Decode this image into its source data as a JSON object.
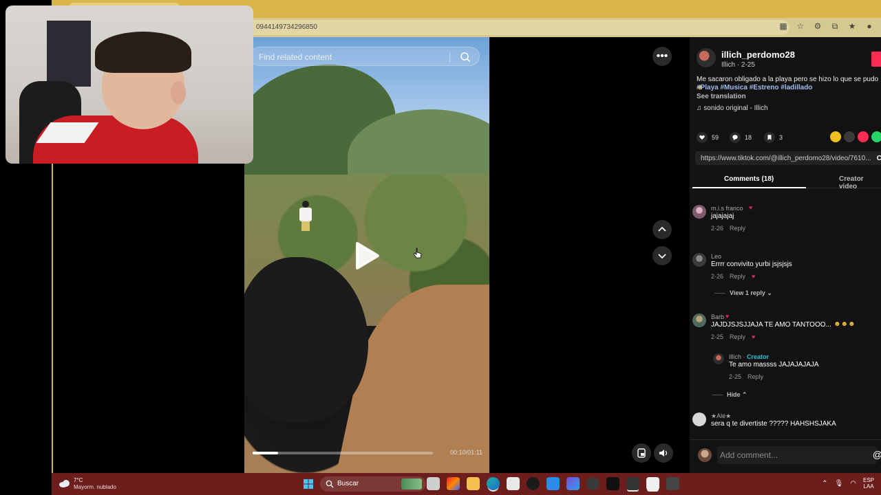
{
  "browser": {
    "url_text": "0944149734296850"
  },
  "video": {
    "search_placeholder": "Find related content",
    "time_display": "00:10/01:11",
    "progress_percent": 14
  },
  "post": {
    "author_name": "illich_perdomo28",
    "author_meta": "Illich · 2-25",
    "caption": "Me sacaron obligado a la playa pero se hizo lo que se pudo",
    "hashtags": "#Playa #Musica #Estreno #ladillado",
    "see_translation": "See translation",
    "sound": "sonido original - Illich",
    "likes": "59",
    "comments_count": "18",
    "saves": "3",
    "link": "https://www.tiktok.com/@illich_perdomo28/video/7610...",
    "copy_label": "C"
  },
  "tabs": {
    "comments": "Comments (18)",
    "creator_videos": "Creator video"
  },
  "comments": [
    {
      "user": "m.i.s franco",
      "text": "jajajajaj",
      "date": "2-26",
      "reply": "Reply"
    },
    {
      "user": "Leo",
      "text": "Errrr convivito yurbi jsjsjsjs",
      "date": "2-26",
      "reply": "Reply",
      "view_replies": "View 1 reply"
    },
    {
      "user": "Barb",
      "text": "JAJDJSJSJJAJA TE AMO TANTOOO...",
      "date": "2-25",
      "reply": "Reply"
    },
    {
      "user": "Illich",
      "creator_tag": "Creator",
      "text": "Te amo massss JAJAJAJAJA",
      "date": "2-25",
      "reply": "Reply",
      "hide": "Hide"
    },
    {
      "user": "★Ale★",
      "text": "sera q te divertiste ????? HAHSHSJAKA"
    }
  ],
  "add_comment_placeholder": "Add comment...",
  "taskbar": {
    "temperature": "7°C",
    "weather": "Mayorm. nublado",
    "search_label": "Buscar",
    "lang_top": "ESP",
    "lang_bottom": "LAA"
  },
  "colors": {
    "accent": "#fe2c55",
    "creator": "#2ebfd6",
    "taskbar": "#6b1e1c",
    "tabstrip": "#d9b54a"
  }
}
